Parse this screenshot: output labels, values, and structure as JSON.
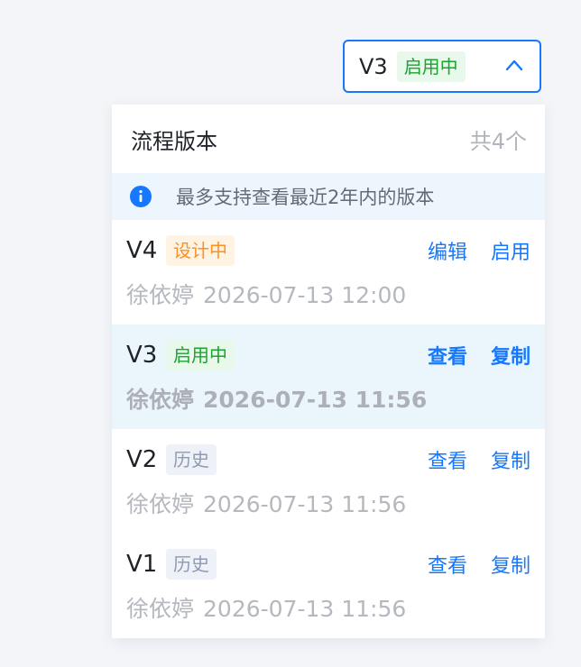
{
  "selector": {
    "version": "V3",
    "status": "启用中",
    "chevron_icon": "chevron-up-icon"
  },
  "panel": {
    "title": "流程版本",
    "count": "共4个",
    "info": {
      "icon": "info-icon",
      "text": "最多支持查看最近2年内的版本"
    },
    "versions": [
      {
        "name": "V4",
        "status": "设计中",
        "status_type": "design",
        "actions": [
          "编辑",
          "启用"
        ],
        "author": "徐依婷",
        "time": "2026-07-13 12:00",
        "current": false
      },
      {
        "name": "V3",
        "status": "启用中",
        "status_type": "active",
        "actions": [
          "查看",
          "复制"
        ],
        "author": "徐依婷",
        "time": "2026-07-13 11:56",
        "current": true
      },
      {
        "name": "V2",
        "status": "历史",
        "status_type": "history",
        "actions": [
          "查看",
          "复制"
        ],
        "author": "徐依婷",
        "time": "2026-07-13 11:56",
        "current": false
      },
      {
        "name": "V1",
        "status": "历史",
        "status_type": "history",
        "actions": [
          "查看",
          "复制"
        ],
        "author": "徐依婷",
        "time": "2026-07-13 11:56",
        "current": false
      }
    ]
  },
  "colors": {
    "accent": "#1677ff",
    "active": "#1aa52f",
    "design": "#ff8f1f",
    "history": "#8f9bb3"
  }
}
